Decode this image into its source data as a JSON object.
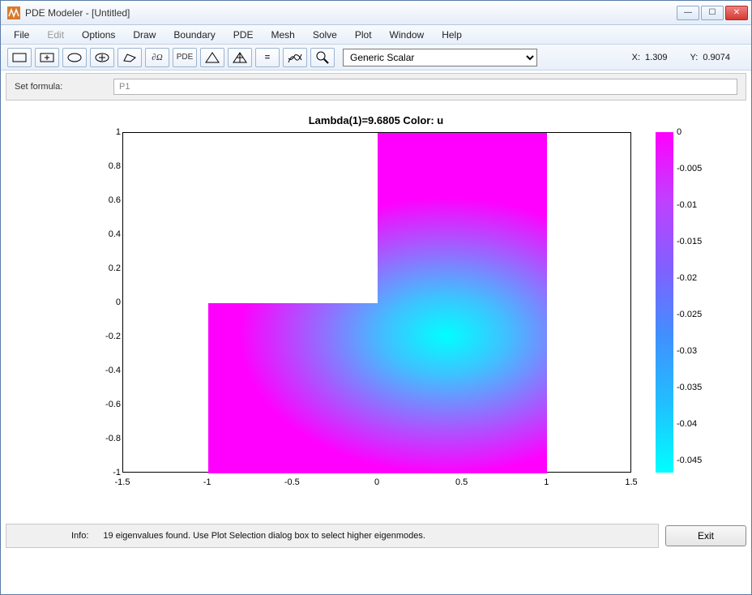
{
  "window": {
    "title": "PDE Modeler - [Untitled]"
  },
  "menu": {
    "file": "File",
    "edit": "Edit",
    "options": "Options",
    "draw": "Draw",
    "boundary": "Boundary",
    "pde": "PDE",
    "mesh": "Mesh",
    "solve": "Solve",
    "plot": "Plot",
    "windowm": "Window",
    "help": "Help"
  },
  "toolbar": {
    "pde_label": "PDE",
    "dropdown_value": "Generic Scalar",
    "coord_x_label": "X:",
    "coord_x": "1.309",
    "coord_y_label": "Y:",
    "coord_y": "0.9074"
  },
  "formula": {
    "label": "Set formula:",
    "value": "P1"
  },
  "chart_data": {
    "type": "heatmap",
    "title": "Lambda(1)=9.6805   Color: u",
    "xlim": [
      -1.5,
      1.5
    ],
    "ylim": [
      -1,
      1
    ],
    "xticks": [
      -1.5,
      -1,
      -0.5,
      0,
      0.5,
      1,
      1.5
    ],
    "yticks": [
      -1,
      -0.8,
      -0.6,
      -0.4,
      -0.2,
      0,
      0.2,
      0.4,
      0.6,
      0.8,
      1
    ],
    "region": "L-shape: union of [-1,1]x[-1,0] and [0,1]x[0,1]",
    "colorbar": {
      "ticks": [
        0,
        -0.005,
        -0.01,
        -0.015,
        -0.02,
        -0.025,
        -0.03,
        -0.035,
        -0.04,
        -0.045
      ],
      "colormap": "cool"
    },
    "eigenvalue_center_approx": [
      0.4,
      -0.3
    ]
  },
  "axis_labels": {
    "y": [
      "1",
      "0.8",
      "0.6",
      "0.4",
      "0.2",
      "0",
      "-0.2",
      "-0.4",
      "-0.6",
      "-0.8",
      "-1"
    ],
    "x": [
      "-1.5",
      "-1",
      "-0.5",
      "0",
      "0.5",
      "1",
      "1.5"
    ],
    "cb": [
      "0",
      "-0.005",
      "-0.01",
      "-0.015",
      "-0.02",
      "-0.025",
      "-0.03",
      "-0.035",
      "-0.04",
      "-0.045"
    ]
  },
  "status": {
    "info_label": "Info:",
    "info_text": "19 eigenvalues found. Use Plot Selection dialog box to select higher eigenmodes.",
    "exit": "Exit"
  }
}
